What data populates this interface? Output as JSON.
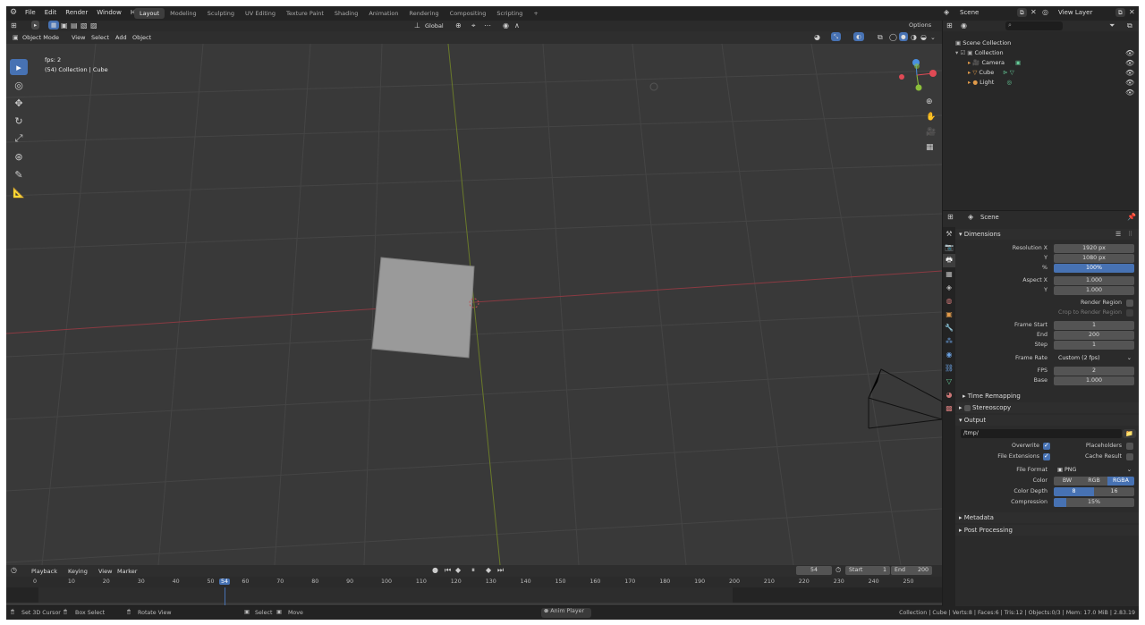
{
  "topbar": {
    "menus": [
      "File",
      "Edit",
      "Render",
      "Window",
      "Help"
    ],
    "workspaces": [
      "Layout",
      "Modeling",
      "Sculpting",
      "UV Editing",
      "Texture Paint",
      "Shading",
      "Animation",
      "Rendering",
      "Compositing",
      "Scripting"
    ],
    "active_workspace": "Layout",
    "add_tab": "+",
    "scene_name": "Scene",
    "view_layer": "View Layer"
  },
  "viewport_header": {
    "mode": "Object Mode",
    "menus": [
      "View",
      "Select",
      "Add",
      "Object"
    ],
    "orientation": "Global",
    "options": "Options"
  },
  "viewport": {
    "overlay_line1": "fps: 2",
    "overlay_line2": "(54) Collection | Cube",
    "gizmo_axes": [
      "X",
      "Y",
      "Z"
    ]
  },
  "outliner": {
    "root": "Scene Collection",
    "collection": "Collection",
    "items": [
      "Camera",
      "Cube",
      "Light"
    ]
  },
  "properties": {
    "context": "Scene",
    "dimensions_title": "Dimensions",
    "resolution_x_label": "Resolution X",
    "resolution_x": "1920 px",
    "y_label": "Y",
    "resolution_y": "1080 px",
    "pct_label": "%",
    "resolution_pct": "100%",
    "aspect_x_label": "Aspect X",
    "aspect_x": "1.000",
    "aspect_y": "1.000",
    "render_region": "Render Region",
    "crop_region": "Crop to Render Region",
    "frame_start_label": "Frame Start",
    "frame_start": "1",
    "end_label": "End",
    "frame_end": "200",
    "step_label": "Step",
    "frame_step": "1",
    "frame_rate_label": "Frame Rate",
    "frame_rate": "Custom (2 fps)",
    "fps_label": "FPS",
    "fps": "2",
    "base_label": "Base",
    "fps_base": "1.000",
    "time_remapping": "Time Remapping",
    "stereoscopy": "Stereoscopy",
    "output_title": "Output",
    "output_path": "/tmp/",
    "overwrite": "Overwrite",
    "placeholders": "Placeholders",
    "file_extensions": "File Extensions",
    "cache_result": "Cache Result",
    "file_format_label": "File Format",
    "file_format": "PNG",
    "color_label": "Color",
    "color_options": [
      "BW",
      "RGB",
      "RGBA"
    ],
    "color_selected": "RGBA",
    "color_depth_label": "Color Depth",
    "color_depth_options": [
      "8",
      "16"
    ],
    "color_depth_selected": "8",
    "compression_label": "Compression",
    "compression": "15%",
    "compression_value": 0.15,
    "metadata": "Metadata",
    "post_processing": "Post Processing"
  },
  "timeline": {
    "menus": [
      "Playback",
      "Keying",
      "View",
      "Marker"
    ],
    "current_frame": "54",
    "start_label": "Start",
    "start": "1",
    "end_label": "End",
    "end": "200",
    "ruler": [
      "0",
      "10",
      "20",
      "30",
      "40",
      "50",
      "54",
      "60",
      "70",
      "80",
      "90",
      "100",
      "110",
      "120",
      "130",
      "140",
      "150",
      "160",
      "170",
      "180",
      "190",
      "200",
      "210",
      "220",
      "230",
      "240",
      "250"
    ]
  },
  "statusbar": {
    "hint1": "Set 3D Cursor",
    "hint2": "Box Select",
    "hint3": "Rotate View",
    "hint4": "Select",
    "hint5": "Move",
    "center": "Anim Player",
    "stats": "Collection | Cube | Verts:8 | Faces:6 | Tris:12 | Objects:0/3 | Mem: 17.0 MiB | 2.83.19"
  },
  "colors": {
    "accent": "#4772b3",
    "x_axis": "#e04a55",
    "y_axis": "#8cbf3a",
    "z_axis": "#4a8fe0"
  }
}
